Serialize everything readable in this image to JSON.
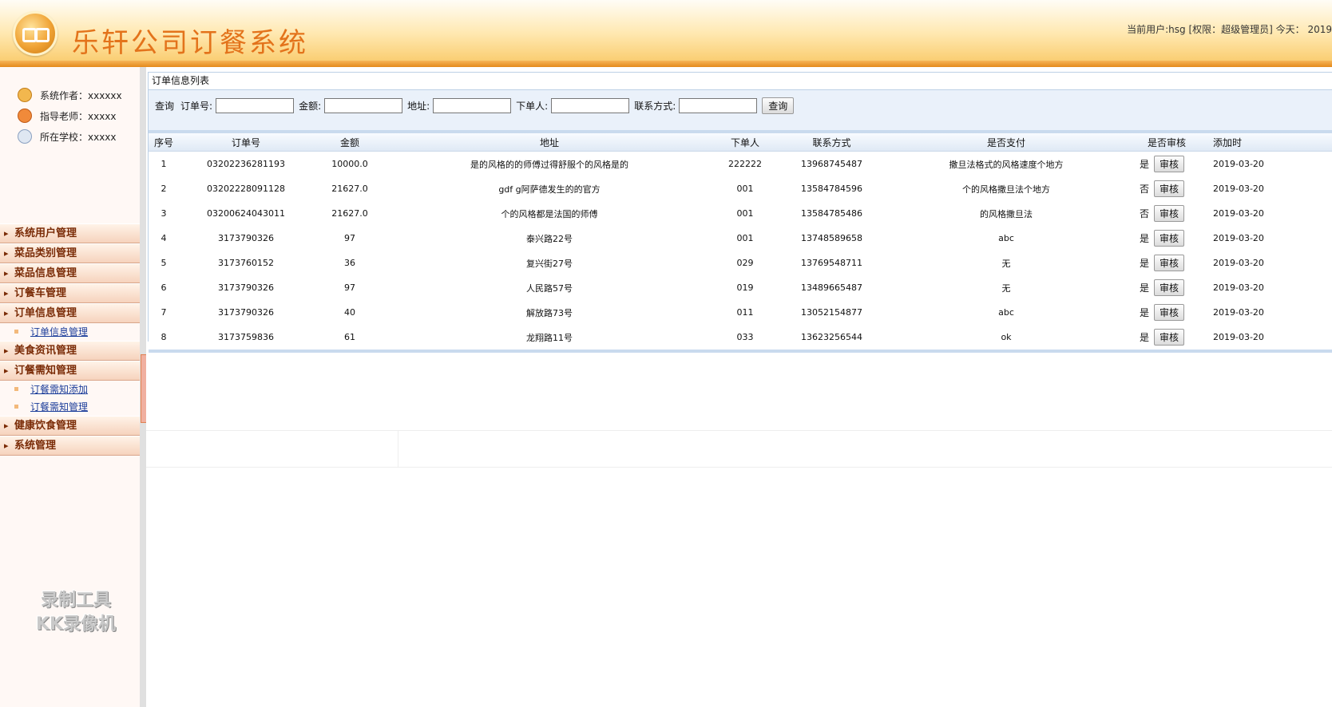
{
  "header": {
    "title": "乐轩公司订餐系统",
    "user_info": "当前用户:hsg [权限：超级管理员] 今天： 2019"
  },
  "sidebar": {
    "info": [
      {
        "label": "系统作者：xxxxxx",
        "icon": "author-icon"
      },
      {
        "label": "指导老师：xxxxx",
        "icon": "teacher-icon"
      },
      {
        "label": "所在学校：xxxxx",
        "icon": "school-icon"
      }
    ],
    "menu": [
      {
        "label": "系统用户管理"
      },
      {
        "label": "菜品类别管理"
      },
      {
        "label": "菜品信息管理"
      },
      {
        "label": "订餐车管理"
      },
      {
        "label": "订单信息管理",
        "subs": [
          "订单信息管理"
        ]
      },
      {
        "label": "美食资讯管理"
      },
      {
        "label": "订餐需知管理",
        "subs": [
          "订餐需知添加",
          "订餐需知管理"
        ]
      },
      {
        "label": "健康饮食管理"
      },
      {
        "label": "系统管理"
      }
    ],
    "watermark_line1": "录制工具",
    "watermark_line2": "KK录像机"
  },
  "panel": {
    "title": "订单信息列表",
    "search": {
      "prefix": "查询",
      "order_no_label": "订单号:",
      "amount_label": "金额:",
      "address_label": "地址:",
      "orderer_label": "下单人:",
      "contact_label": "联系方式:",
      "button_label": "查询"
    }
  },
  "table": {
    "columns": [
      "序号",
      "订单号",
      "金额",
      "地址",
      "下单人",
      "联系方式",
      "是否支付",
      "是否审核",
      "添加时"
    ],
    "audit_button_label": "审核",
    "rows": [
      {
        "idx": "1",
        "order_no": "03202236281193",
        "amount": "10000.0",
        "address": "是的风格的的师傅过得舒服个的风格是的",
        "orderer": "222222",
        "contact": "13968745487",
        "paid": "撒旦法格式的风格速度个地方",
        "audited": "是",
        "date": "2019-03-20"
      },
      {
        "idx": "2",
        "order_no": "03202228091128",
        "amount": "21627.0",
        "address": "gdf g阿萨德发生的的官方",
        "orderer": "001",
        "contact": "13584784596",
        "paid": "个的风格撒旦法个地方",
        "audited": "否",
        "date": "2019-03-20"
      },
      {
        "idx": "3",
        "order_no": "03200624043011",
        "amount": "21627.0",
        "address": "个的风格都是法国的师傅",
        "orderer": "001",
        "contact": "13584785486",
        "paid": "的风格撒旦法",
        "audited": "否",
        "date": "2019-03-20"
      },
      {
        "idx": "4",
        "order_no": "3173790326",
        "amount": "97",
        "address": "泰兴路22号",
        "orderer": "001",
        "contact": "13748589658",
        "paid": "abc",
        "audited": "是",
        "date": "2019-03-20"
      },
      {
        "idx": "5",
        "order_no": "3173760152",
        "amount": "36",
        "address": "复兴街27号",
        "orderer": "029",
        "contact": "13769548711",
        "paid": "无",
        "audited": "是",
        "date": "2019-03-20"
      },
      {
        "idx": "6",
        "order_no": "3173790326",
        "amount": "97",
        "address": "人民路57号",
        "orderer": "019",
        "contact": "13489665487",
        "paid": "无",
        "audited": "是",
        "date": "2019-03-20"
      },
      {
        "idx": "7",
        "order_no": "3173790326",
        "amount": "40",
        "address": "解放路73号",
        "orderer": "011",
        "contact": "13052154877",
        "paid": "abc",
        "audited": "是",
        "date": "2019-03-20"
      },
      {
        "idx": "8",
        "order_no": "3173759836",
        "amount": "61",
        "address": "龙翔路11号",
        "orderer": "033",
        "contact": "13623256544",
        "paid": "ok",
        "audited": "是",
        "date": "2019-03-20"
      }
    ]
  },
  "colors": {
    "title": "#e3731b",
    "menu_text": "#7a2b06",
    "sub_link": "#1b3d9a",
    "header_gradient_bottom": "#f9c865"
  }
}
